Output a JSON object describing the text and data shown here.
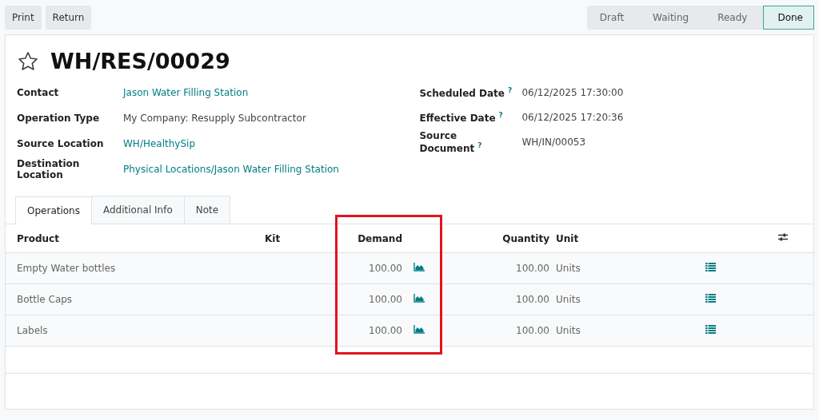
{
  "actions": [
    "Print",
    "Return"
  ],
  "stages": [
    {
      "label": "Draft",
      "selected": false
    },
    {
      "label": "Waiting",
      "selected": false
    },
    {
      "label": "Ready",
      "selected": false
    },
    {
      "label": "Done",
      "selected": true
    }
  ],
  "title": "WH/RES/00029",
  "starred": false,
  "fields_left": [
    {
      "label": "Contact",
      "value": "Jason Water Filling Station",
      "kind": "link"
    },
    {
      "label": "Operation Type",
      "value": "My Company: Resupply Subcontractor",
      "kind": "text"
    },
    {
      "label": "Source Location",
      "value": "WH/HealthySip",
      "kind": "link"
    },
    {
      "label": "Destination Location",
      "value": "Physical Locations/Jason Water Filling Station",
      "kind": "link"
    }
  ],
  "fields_right": [
    {
      "label": "Scheduled Date",
      "help": "?",
      "value": "06/12/2025 17:30:00"
    },
    {
      "label": "Effective Date",
      "help": "?",
      "value": "06/12/2025 17:20:36"
    },
    {
      "label": "Source Document",
      "help": "?",
      "value": "WH/IN/00053"
    }
  ],
  "tabs": [
    {
      "label": "Operations",
      "selected": true
    },
    {
      "label": "Additional Info",
      "selected": false
    },
    {
      "label": "Note",
      "selected": false
    }
  ],
  "table": {
    "columns": [
      "Product",
      "Kit",
      "Demand",
      "Quantity",
      "Unit"
    ],
    "rows": [
      {
        "product": "Empty Water bottles",
        "demand": "100.00",
        "quantity": "100.00",
        "unit": "Units"
      },
      {
        "product": "Bottle Caps",
        "demand": "100.00",
        "quantity": "100.00",
        "unit": "Units"
      },
      {
        "product": "Labels",
        "demand": "100.00",
        "quantity": "100.00",
        "unit": "Units"
      }
    ]
  },
  "highlight": {
    "shown": true
  }
}
